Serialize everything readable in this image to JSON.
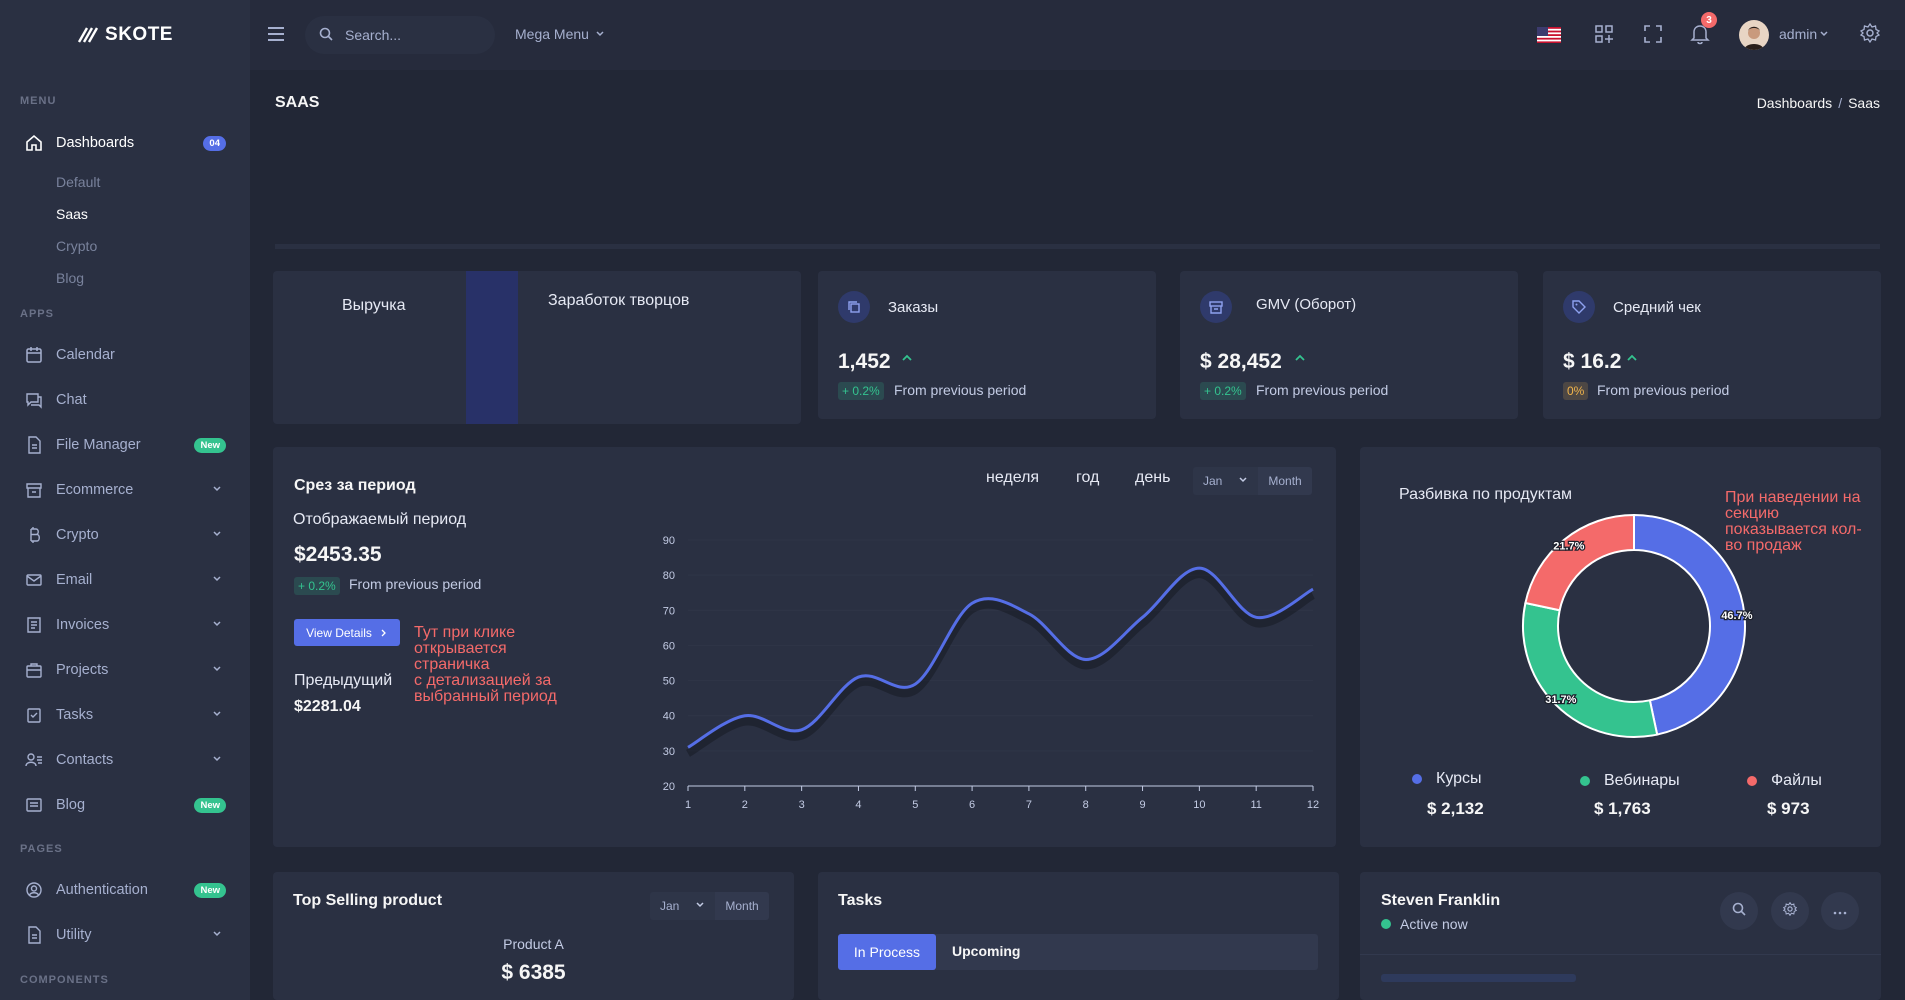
{
  "app": {
    "name": "SKOTE"
  },
  "topbar": {
    "search_placeholder": "Search...",
    "mega_menu": "Mega Menu",
    "notification_count": "3",
    "user": "admin"
  },
  "sidebar": {
    "sections": {
      "menu": "MENU",
      "apps": "APPS",
      "pages": "PAGES",
      "components": "COMPONENTS"
    },
    "dashboards": {
      "label": "Dashboards",
      "badge": "04"
    },
    "sub_items": [
      "Default",
      "Saas",
      "Crypto",
      "Blog"
    ],
    "apps": [
      {
        "label": "Calendar"
      },
      {
        "label": "Chat"
      },
      {
        "label": "File Manager",
        "badge": "New"
      },
      {
        "label": "Ecommerce"
      },
      {
        "label": "Crypto"
      },
      {
        "label": "Email"
      },
      {
        "label": "Invoices"
      },
      {
        "label": "Projects"
      },
      {
        "label": "Tasks"
      },
      {
        "label": "Contacts"
      },
      {
        "label": "Blog",
        "badge": "New"
      }
    ],
    "pages": [
      {
        "label": "Authentication",
        "badge": "New"
      },
      {
        "label": "Utility"
      }
    ]
  },
  "page": {
    "title": "SAAS",
    "breadcrumb": [
      "Dashboards",
      "Saas"
    ]
  },
  "stats": {
    "revenue_label": "Выручка",
    "creators_label": "Заработок творцов",
    "cards": [
      {
        "label": "Заказы",
        "value": "1,452",
        "pct": "+ 0.2%",
        "from": "From previous period"
      },
      {
        "label": "GMV (Оборот)",
        "value": "$ 28,452",
        "pct": "+ 0.2%",
        "from": "From previous period"
      },
      {
        "label": "Средний чек",
        "value": "$ 16.2",
        "pct": "0%",
        "from": "From previous period"
      }
    ]
  },
  "period": {
    "title": "Срез за период",
    "subtitle": "Отображаемый период",
    "value": "$2453.35",
    "pct": "+ 0.2%",
    "from": "From previous period",
    "button": "View Details",
    "prev_label": "Предыдущий",
    "prev_value": "$2281.04",
    "note_lines": [
      "Тут при клике",
      "открывается",
      "страничка",
      "с детализацией за",
      "выбранный период"
    ],
    "tabs": [
      "неделя",
      "год",
      "день"
    ],
    "select_month": "Jan",
    "month_btn": "Month"
  },
  "chart_data": {
    "type": "line",
    "x": [
      1,
      2,
      3,
      4,
      5,
      6,
      7,
      8,
      9,
      10,
      11,
      12
    ],
    "series": [
      {
        "values": [
          31,
          40,
          36,
          51,
          49,
          72,
          69,
          56,
          68,
          82,
          68,
          76
        ]
      }
    ],
    "ylim": [
      20,
      90
    ],
    "yticks": [
      20,
      30,
      40,
      50,
      60,
      70,
      80,
      90
    ],
    "color": "#556ee6"
  },
  "products": {
    "title": "Разбивка по продуктам",
    "note_lines": [
      "При наведении на",
      "секцию",
      "показывается кол-",
      "во продаж"
    ],
    "donut": {
      "type": "pie",
      "slices": [
        {
          "name": "Курсы",
          "value": 46.7,
          "label": "46.7%",
          "color": "#556ee6"
        },
        {
          "name": "Вебинары",
          "value": 31.7,
          "label": "31.7%",
          "color": "#34c38f"
        },
        {
          "name": "Файлы",
          "value": 21.7,
          "label": "21.7%",
          "color": "#f46a6a"
        }
      ]
    },
    "legend": [
      {
        "name": "Курсы",
        "value": "$ 2,132",
        "color": "#556ee6"
      },
      {
        "name": "Вебинары",
        "value": "$ 1,763",
        "color": "#34c38f"
      },
      {
        "name": "Файлы",
        "value": "$ 973",
        "color": "#f46a6a"
      }
    ]
  },
  "top_selling": {
    "title": "Top Selling product",
    "select_month": "Jan",
    "month_btn": "Month",
    "product": "Product A",
    "value": "$ 6385"
  },
  "tasks": {
    "title": "Tasks",
    "tabs": [
      "In Process",
      "Upcoming"
    ]
  },
  "chat": {
    "name": "Steven Franklin",
    "status": "Active now"
  }
}
